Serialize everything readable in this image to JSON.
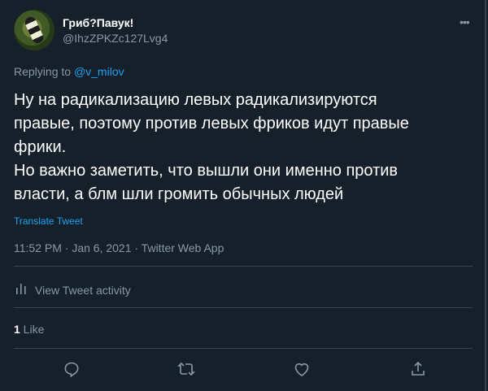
{
  "header": {
    "display_name": "Гриб?Павук!",
    "handle": "@IhzZPKZc127Lvg4",
    "more_icon": "more-icon"
  },
  "reply": {
    "prefix": "Replying to ",
    "mention": "@v_milov"
  },
  "tweet": {
    "lines": [
      "Ну на радикализацию левых радикализируются",
      "правые, поэтому против левых фриков идут правые",
      "фрики.",
      "Но важно заметить, что вышли они именно против",
      "власти, а блм шли громить обычных людей"
    ],
    "translate_label": "Translate Tweet",
    "timestamp": "11:52 PM · Jan 6, 2021 · Twitter Web App"
  },
  "activity": {
    "label": "View Tweet activity",
    "icon": "bar-chart-icon"
  },
  "stats": {
    "like_count": "1",
    "like_label": " Like"
  },
  "actions": [
    {
      "name": "reply",
      "icon": "reply-icon"
    },
    {
      "name": "retweet",
      "icon": "retweet-icon"
    },
    {
      "name": "like",
      "icon": "heart-icon"
    },
    {
      "name": "share",
      "icon": "share-icon"
    }
  ],
  "colors": {
    "background": "#15202b",
    "text": "#ffffff",
    "secondary": "#8899a6",
    "accent": "#1da1f2",
    "divider": "#38444d"
  }
}
